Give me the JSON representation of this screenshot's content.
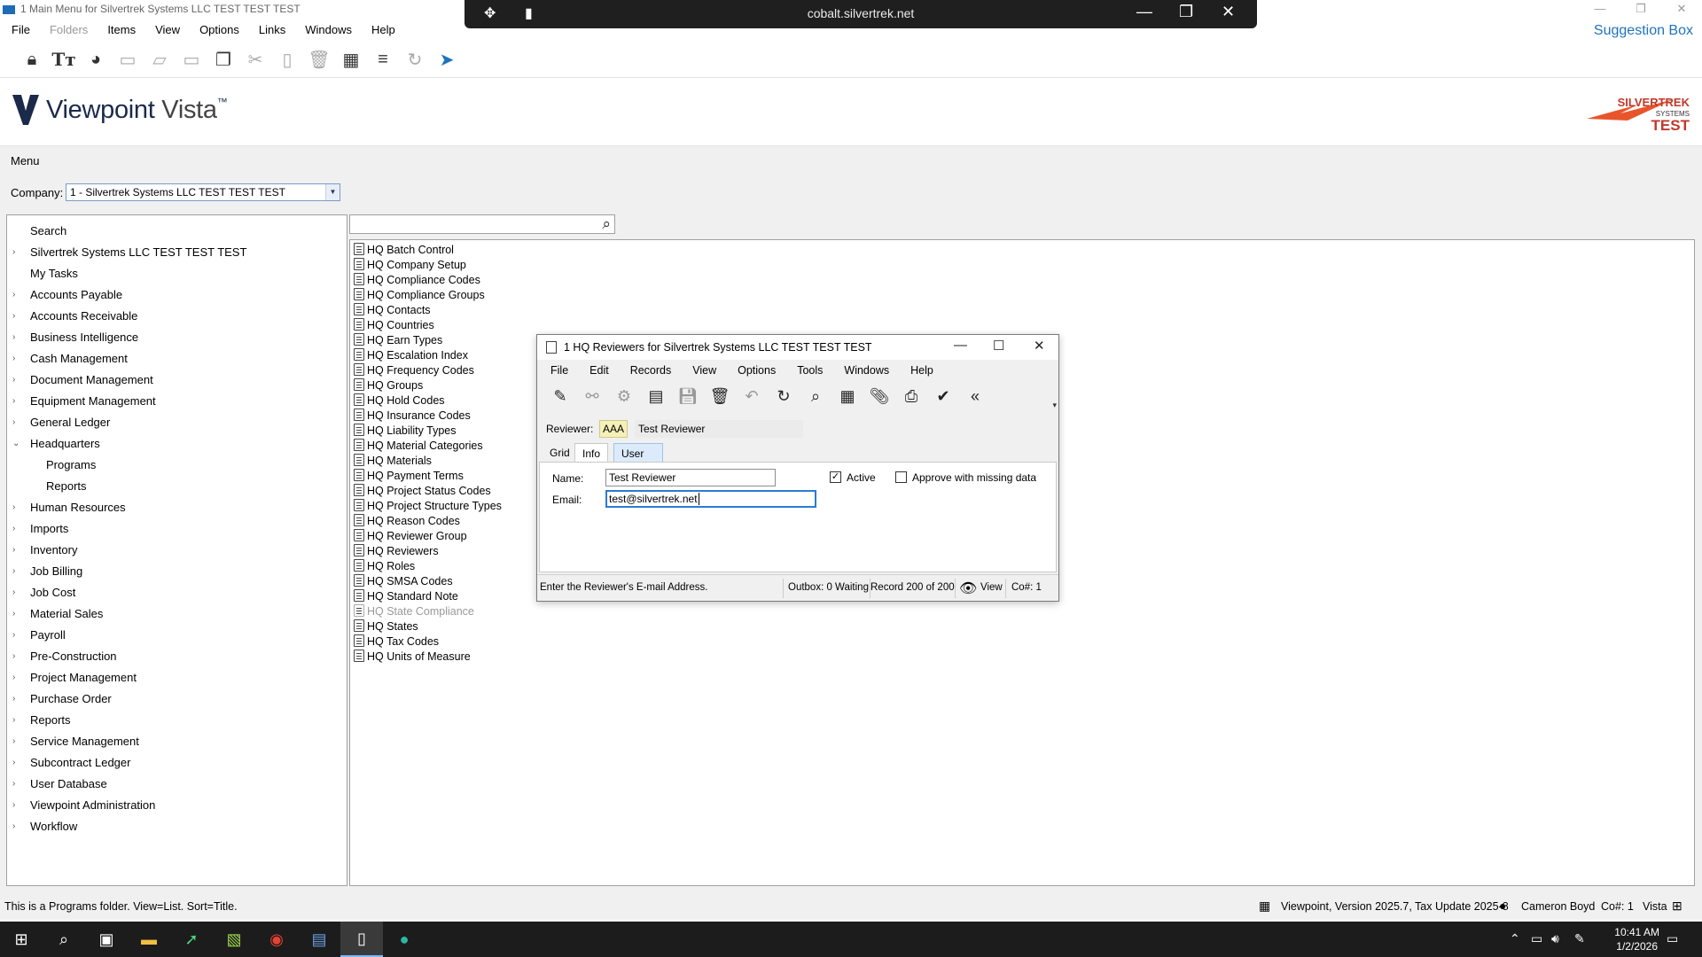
{
  "window": {
    "title": "1 Main Menu for Silvertrek Systems LLC TEST TEST TEST",
    "minimize": "—",
    "restore": "❐",
    "close": "✕"
  },
  "remote": {
    "host": "cobalt.silvertrek.net",
    "minimize": "—",
    "restore": "❐",
    "close": "✕"
  },
  "menubar": {
    "items": [
      "File",
      "Folders",
      "Items",
      "View",
      "Options",
      "Links",
      "Windows",
      "Help"
    ],
    "disabled_index": 1
  },
  "suggestion_box": "Suggestion Box",
  "logo": {
    "brand": "Viewpoint",
    "product": "Vista",
    "tm": "™",
    "company_logo_text": "SILVERTREK SYSTEMS TEST",
    "brand_color": "#1b2a4a",
    "accent_color": "#e8552b"
  },
  "menu_label": "Menu",
  "company": {
    "label": "Company:",
    "value": "1 - Silvertrek Systems LLC TEST TEST TEST"
  },
  "tree": [
    {
      "label": "Search",
      "expander": ""
    },
    {
      "label": "Silvertrek Systems LLC TEST TEST TEST",
      "expander": "›"
    },
    {
      "label": "My Tasks",
      "expander": ""
    },
    {
      "label": "Accounts Payable",
      "expander": "›"
    },
    {
      "label": "Accounts Receivable",
      "expander": "›"
    },
    {
      "label": "Business Intelligence",
      "expander": "›"
    },
    {
      "label": "Cash Management",
      "expander": "›"
    },
    {
      "label": "Document Management",
      "expander": "›"
    },
    {
      "label": "Equipment Management",
      "expander": "›"
    },
    {
      "label": "General Ledger",
      "expander": "›"
    },
    {
      "label": "Headquarters",
      "expander": "⌄"
    },
    {
      "label": "Programs",
      "expander": ""
    },
    {
      "label": "Reports",
      "expander": ""
    },
    {
      "label": "Human Resources",
      "expander": "›"
    },
    {
      "label": "Imports",
      "expander": "›"
    },
    {
      "label": "Inventory",
      "expander": "›"
    },
    {
      "label": "Job Billing",
      "expander": "›"
    },
    {
      "label": "Job Cost",
      "expander": "›"
    },
    {
      "label": "Material Sales",
      "expander": "›"
    },
    {
      "label": "Payroll",
      "expander": "›"
    },
    {
      "label": "Pre-Construction",
      "expander": "›"
    },
    {
      "label": "Project Management",
      "expander": "›"
    },
    {
      "label": "Purchase Order",
      "expander": "›"
    },
    {
      "label": "Reports",
      "expander": "›"
    },
    {
      "label": "Service Management",
      "expander": "›"
    },
    {
      "label": "Subcontract Ledger",
      "expander": "›"
    },
    {
      "label": "User Database",
      "expander": "›"
    },
    {
      "label": "Viewpoint Administration",
      "expander": "›"
    },
    {
      "label": "Workflow",
      "expander": "›"
    }
  ],
  "programs": [
    "HQ Batch Control",
    "HQ Company Setup",
    "HQ Compliance Codes",
    "HQ Compliance Groups",
    "HQ Contacts",
    "HQ Countries",
    "HQ Earn Types",
    "HQ Escalation Index",
    "HQ Frequency Codes",
    "HQ Groups",
    "HQ Hold Codes",
    "HQ Insurance Codes",
    "HQ Liability Types",
    "HQ Material Categories",
    "HQ Materials",
    "HQ Payment Terms",
    "HQ Project Status Codes",
    "HQ Project Structure Types",
    "HQ Reason Codes",
    "HQ Reviewer Group",
    "HQ Reviewers",
    "HQ Roles",
    "HQ SMSA Codes",
    "HQ Standard Note",
    "HQ State Compliance",
    "HQ States",
    "HQ Tax Codes",
    "HQ Units of Measure"
  ],
  "programs_disabled_index": 24,
  "dialog": {
    "title": "1 HQ Reviewers for Silvertrek Systems LLC TEST TEST TEST",
    "menu": [
      "File",
      "Edit",
      "Records",
      "View",
      "Options",
      "Tools",
      "Windows",
      "Help"
    ],
    "reviewer_label": "Reviewer:",
    "reviewer_code": "AAA",
    "reviewer_name": "Test Reviewer",
    "tabs": [
      "Grid",
      "Info",
      "User Names"
    ],
    "name_label": "Name:",
    "name_value": "Test Reviewer",
    "email_label": "Email:",
    "email_value": "test@silvertrek.net",
    "active_label": "Active",
    "active_checked": "✓",
    "approve_label": "Approve with missing data",
    "status": {
      "hint": "Enter the Reviewer's E-mail Address.",
      "outbox": "Outbox: 0 Waiting",
      "record": "Record 200 of 200",
      "view": "View",
      "company": "Co#: 1"
    }
  },
  "statusbar": {
    "left": "This is a Programs folder. View=List. Sort=Title.",
    "version": "Viewpoint, Version 2025.7, Tax Update 2025-8",
    "user": "Cameron Boyd",
    "company": "Co#: 1",
    "product": "Vista"
  },
  "taskbar": {
    "time": "10:41 AM",
    "date": "1/2/2026"
  }
}
